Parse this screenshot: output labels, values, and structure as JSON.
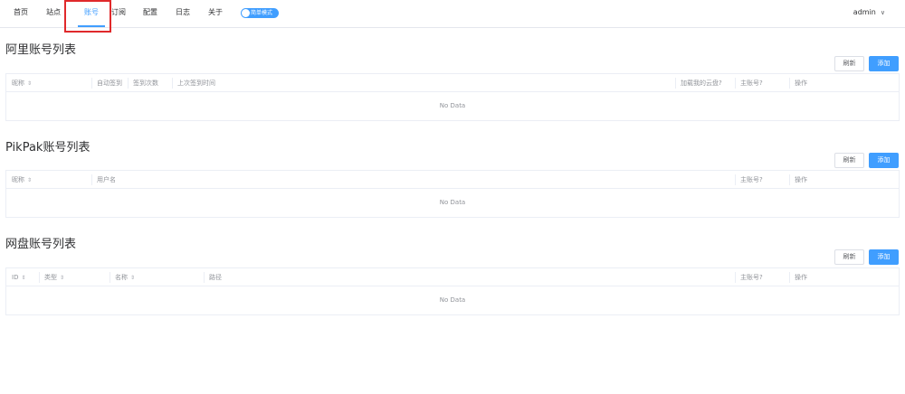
{
  "nav": {
    "items": [
      {
        "label": "首页"
      },
      {
        "label": "站点"
      },
      {
        "label": "账号"
      },
      {
        "label": "订阅"
      },
      {
        "label": "配置"
      },
      {
        "label": "日志"
      },
      {
        "label": "关于"
      }
    ],
    "active_index": 2,
    "mode_toggle_label": "简单模式",
    "user": "admin"
  },
  "colors": {
    "accent": "#409eff",
    "highlight": "#e0292b"
  },
  "buttons": {
    "refresh": "刷新",
    "add": "添加"
  },
  "sort_icon": "⇕",
  "sections": [
    {
      "title": "阿里账号列表",
      "columns": [
        {
          "label": "昵称",
          "sortable": true
        },
        {
          "label": "自动签到",
          "sortable": false
        },
        {
          "label": "签到次数",
          "sortable": false
        },
        {
          "label": "上次签到时间",
          "sortable": false
        },
        {
          "label": "加载我的云盘?",
          "sortable": false
        },
        {
          "label": "主账号?",
          "sortable": false
        },
        {
          "label": "操作",
          "sortable": false
        }
      ],
      "empty_text": "No Data"
    },
    {
      "title": "PikPak账号列表",
      "columns": [
        {
          "label": "昵称",
          "sortable": true
        },
        {
          "label": "用户名",
          "sortable": false
        },
        {
          "label": "主账号?",
          "sortable": false
        },
        {
          "label": "操作",
          "sortable": false
        }
      ],
      "empty_text": "No Data"
    },
    {
      "title": "网盘账号列表",
      "columns": [
        {
          "label": "ID",
          "sortable": true
        },
        {
          "label": "类型",
          "sortable": true
        },
        {
          "label": "名称",
          "sortable": true
        },
        {
          "label": "路径",
          "sortable": false
        },
        {
          "label": "主账号?",
          "sortable": false
        },
        {
          "label": "操作",
          "sortable": false
        }
      ],
      "empty_text": "No Data"
    }
  ]
}
